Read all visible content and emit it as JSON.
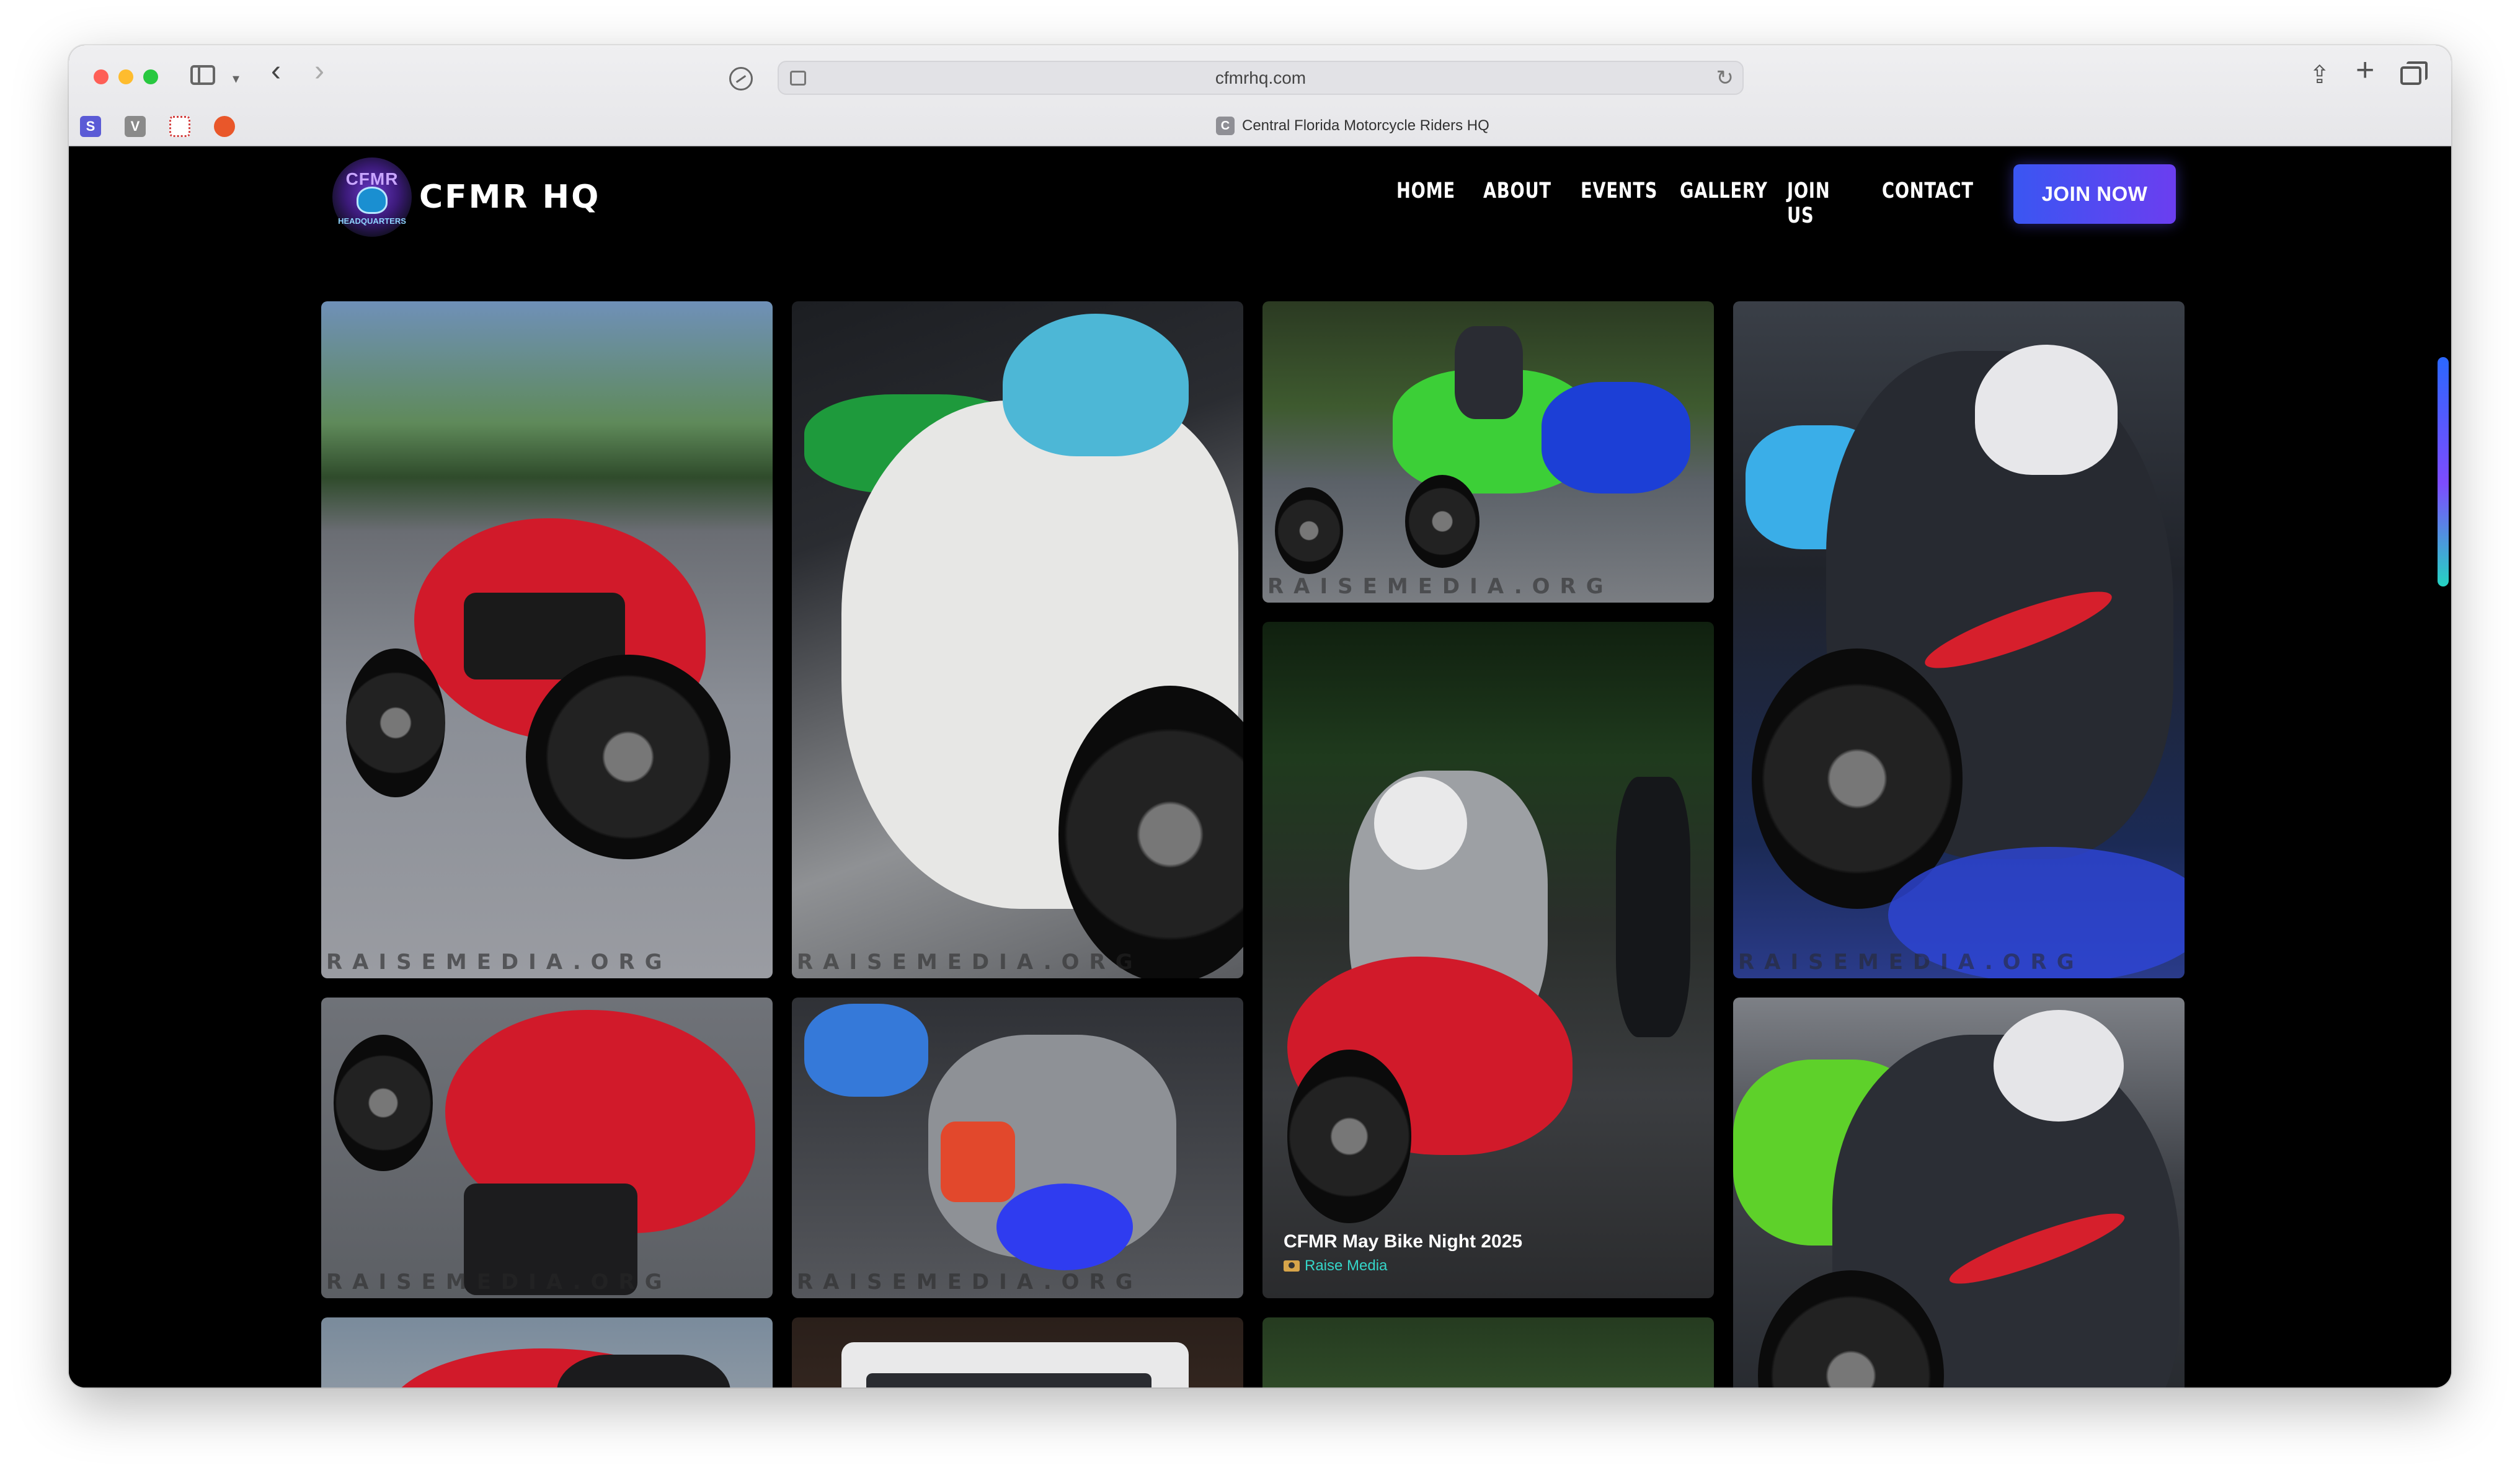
{
  "browser": {
    "url": "cfmrhq.com",
    "tab_title": "Central Florida Motorcycle Riders HQ",
    "favicon_letter": "C",
    "bookmarks": [
      {
        "label": "S",
        "icon": "s-bookmark-icon"
      },
      {
        "label": "V",
        "icon": "v-bookmark-icon"
      },
      {
        "label": "",
        "icon": "flower-bookmark-icon"
      },
      {
        "label": "",
        "icon": "orange-bookmark-icon"
      }
    ]
  },
  "site": {
    "logo": {
      "top": "CFMR",
      "bottom": "HEADQUARTERS"
    },
    "brand": "CFMR HQ",
    "nav": [
      "HOME",
      "ABOUT",
      "EVENTS",
      "GALLERY",
      "JOIN US",
      "CONTACT"
    ],
    "cta": "JOIN NOW",
    "accent_colors": {
      "cta_start": "#3a56f2",
      "cta_end": "#6b3ef0",
      "credit": "#35d5c8"
    }
  },
  "gallery": {
    "watermark": "RAISEMEDIA.ORG",
    "featured_caption": {
      "title": "CFMR May Bike Night 2025",
      "credit": "Raise Media"
    }
  }
}
